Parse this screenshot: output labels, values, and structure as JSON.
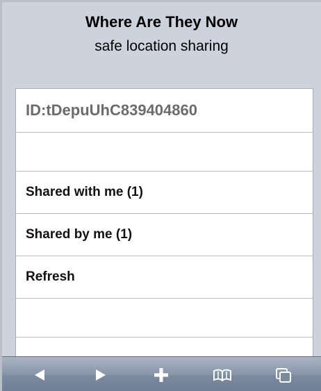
{
  "header": {
    "title": "Where Are They Now",
    "subtitle": "safe location sharing"
  },
  "list": {
    "id_text": "ID:tDepuUhC839404860",
    "items": [
      {
        "label": "Shared with me (1)"
      },
      {
        "label": "Shared by me (1)"
      },
      {
        "label": "Refresh"
      }
    ]
  },
  "toolbar": {
    "buttons": [
      "back-icon",
      "forward-icon",
      "plus-icon",
      "bookmarks-icon",
      "pages-icon"
    ],
    "icon_color": "#ffffff"
  }
}
